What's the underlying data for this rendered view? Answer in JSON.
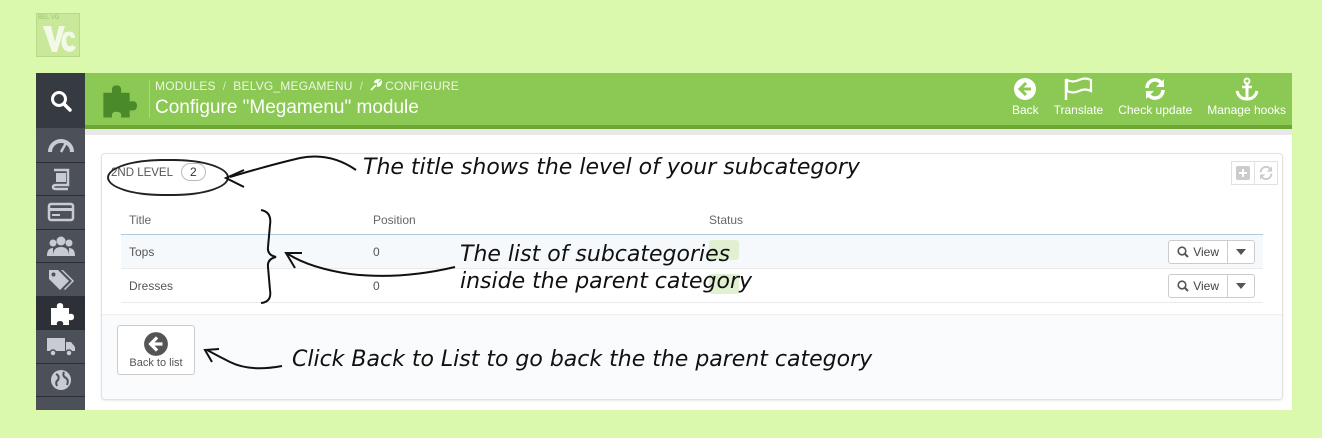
{
  "logo": {
    "text": "BEL VG"
  },
  "breadcrumb": {
    "modules": "MODULES",
    "module": "BELVG_MEGAMENU",
    "configure": "CONFIGURE"
  },
  "page_title": "Configure \"Megamenu\" module",
  "toolbar": [
    {
      "label": "Back",
      "icon": "arrow-left-circle-icon"
    },
    {
      "label": "Translate",
      "icon": "flag-icon"
    },
    {
      "label": "Check update",
      "icon": "refresh-icon"
    },
    {
      "label": "Manage hooks",
      "icon": "anchor-icon"
    }
  ],
  "sidebar": {
    "icons": [
      "search-icon",
      "dashboard-icon",
      "catalog-icon",
      "orders-icon",
      "customers-icon",
      "tags-icon",
      "modules-icon",
      "shipping-icon",
      "localization-icon",
      "preferences-icon"
    ],
    "active": "modules-icon"
  },
  "panel": {
    "level_title": "2ND LEVEL",
    "level_badge": "2",
    "columns": [
      "Title",
      "Position",
      "Status"
    ],
    "rows": [
      {
        "title": "Tops",
        "position": "0",
        "action": "View"
      },
      {
        "title": "Dresses",
        "position": "0",
        "action": "View"
      }
    ],
    "back_label": "Back to list"
  },
  "annotations": {
    "title_note": "The title shows the level of your subcategory",
    "list_note_1": "The list of subcategories",
    "list_note_2": "inside the parent category",
    "back_note": "Click Back to List to go back the the parent category"
  },
  "colors": {
    "background": "#daf9ad",
    "header": "#8bc954",
    "sidebar": "#363a41"
  }
}
